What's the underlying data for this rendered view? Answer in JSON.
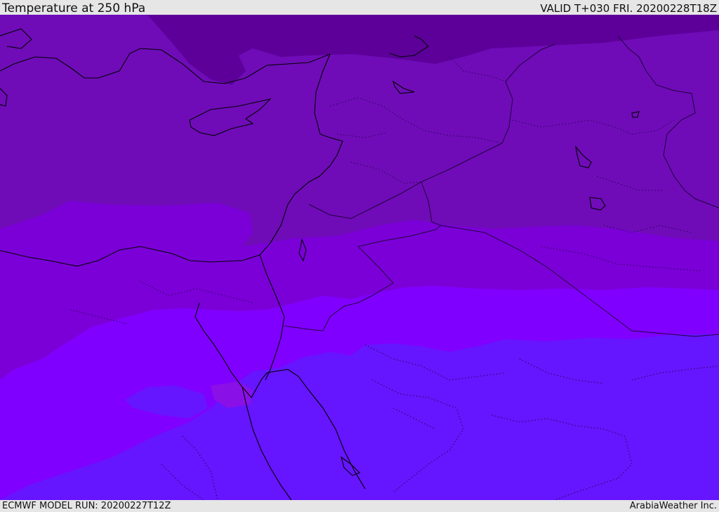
{
  "header": {
    "title": "Temperature at 250 hPa",
    "valid": "VALID T+030 FRI. 20200228T18Z"
  },
  "footer": {
    "model_run": "ECMWF MODEL RUN: 20200227T12Z",
    "brand": "ArabiaWeather Inc."
  },
  "colors": {
    "band_coldest": "#5c0096",
    "band_cold": "#6f0cb8",
    "band_mid": "#7a00d6",
    "band_warm": "#8000ff",
    "band_warmest": "#6414ff",
    "coastline": "#000000",
    "border": "#1a0033"
  }
}
